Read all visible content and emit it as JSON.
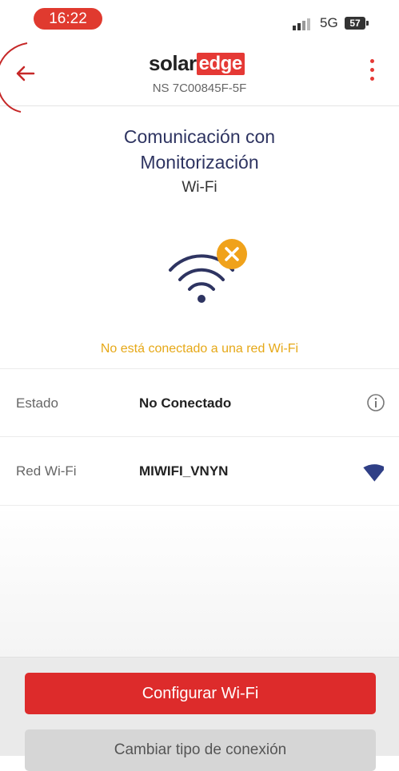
{
  "status_bar": {
    "time": "16:22",
    "network": "5G",
    "battery": "57"
  },
  "header": {
    "logo_left": "solar",
    "logo_right": "edge",
    "serial": "NS 7C00845F-5F"
  },
  "main": {
    "title_line1": "Comunicación con",
    "title_line2": "Monitorización",
    "subtitle": "Wi-Fi",
    "warning": "No está conectado a una red Wi-Fi"
  },
  "rows": [
    {
      "label": "Estado",
      "value": "No Conectado",
      "icon": "info-icon"
    },
    {
      "label": "Red Wi-Fi",
      "value": "MIWIFI_VNYN",
      "icon": "wifi-signal-icon"
    }
  ],
  "buttons": {
    "configure": "Configurar Wi-Fi",
    "change": "Cambiar tipo de conexión"
  },
  "colors": {
    "accent": "#e53935",
    "title": "#2e3461",
    "warning": "#e6a817",
    "icon_blue": "#2f3f86"
  }
}
